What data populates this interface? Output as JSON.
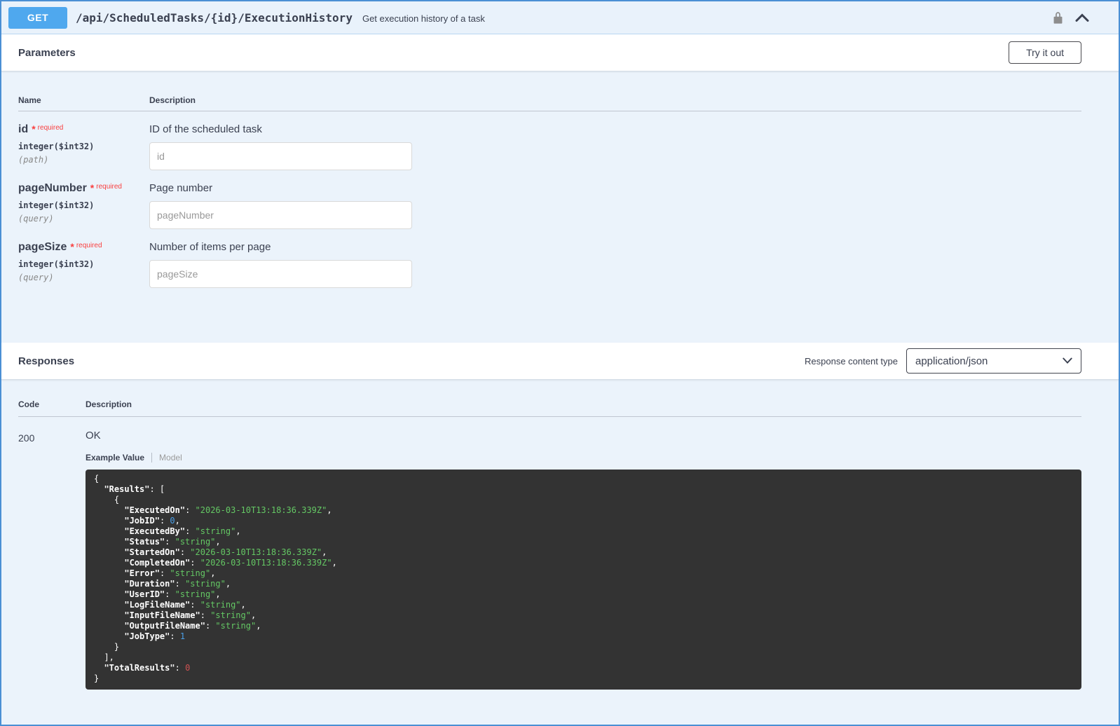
{
  "operation": {
    "method": "GET",
    "path": "/api/ScheduledTasks/{id}/ExecutionHistory",
    "summary": "Get execution history of a task"
  },
  "icons": {
    "lock": "lock-icon",
    "collapse": "chevron-up-icon",
    "select_arrow": "chevron-down-icon"
  },
  "colors": {
    "method_badge": "#4fa8ee",
    "block_background": "#ebf3fb",
    "required": "#f93e3e",
    "code_background": "#333333",
    "string_token": "#64c864",
    "number_token": "#4a9fe8",
    "total_results_token": "#cf5252"
  },
  "parameters_section": {
    "title": "Parameters",
    "try_it_out_label": "Try it out",
    "name_header": "Name",
    "description_header": "Description",
    "required_star": "*",
    "required_label": "required",
    "params": [
      {
        "name": "id",
        "type": "integer($int32)",
        "in": "(path)",
        "description": "ID of the scheduled task",
        "placeholder": "id"
      },
      {
        "name": "pageNumber",
        "type": "integer($int32)",
        "in": "(query)",
        "description": "Page number",
        "placeholder": "pageNumber"
      },
      {
        "name": "pageSize",
        "type": "integer($int32)",
        "in": "(query)",
        "description": "Number of items per page",
        "placeholder": "pageSize"
      }
    ]
  },
  "responses_section": {
    "title": "Responses",
    "content_type_label": "Response content type",
    "content_type_value": "application/json",
    "code_header": "Code",
    "description_header": "Description",
    "responses": [
      {
        "code": "200",
        "description": "OK",
        "example_tab_label": "Example Value",
        "model_tab_label": "Model",
        "example_lines": [
          [
            [
              "{",
              "p"
            ]
          ],
          [
            [
              "  ",
              "p"
            ],
            [
              "\"Results\"",
              "k"
            ],
            [
              ": [",
              "p"
            ]
          ],
          [
            [
              "    {",
              "p"
            ]
          ],
          [
            [
              "      ",
              "p"
            ],
            [
              "\"ExecutedOn\"",
              "k"
            ],
            [
              ": ",
              "p"
            ],
            [
              "\"2026-03-10T13:18:36.339Z\"",
              "s"
            ],
            [
              ",",
              "p"
            ]
          ],
          [
            [
              "      ",
              "p"
            ],
            [
              "\"JobID\"",
              "k"
            ],
            [
              ": ",
              "p"
            ],
            [
              "0",
              "n"
            ],
            [
              ",",
              "p"
            ]
          ],
          [
            [
              "      ",
              "p"
            ],
            [
              "\"ExecutedBy\"",
              "k"
            ],
            [
              ": ",
              "p"
            ],
            [
              "\"string\"",
              "s"
            ],
            [
              ",",
              "p"
            ]
          ],
          [
            [
              "      ",
              "p"
            ],
            [
              "\"Status\"",
              "k"
            ],
            [
              ": ",
              "p"
            ],
            [
              "\"string\"",
              "s"
            ],
            [
              ",",
              "p"
            ]
          ],
          [
            [
              "      ",
              "p"
            ],
            [
              "\"StartedOn\"",
              "k"
            ],
            [
              ": ",
              "p"
            ],
            [
              "\"2026-03-10T13:18:36.339Z\"",
              "s"
            ],
            [
              ",",
              "p"
            ]
          ],
          [
            [
              "      ",
              "p"
            ],
            [
              "\"CompletedOn\"",
              "k"
            ],
            [
              ": ",
              "p"
            ],
            [
              "\"2026-03-10T13:18:36.339Z\"",
              "s"
            ],
            [
              ",",
              "p"
            ]
          ],
          [
            [
              "      ",
              "p"
            ],
            [
              "\"Error\"",
              "k"
            ],
            [
              ": ",
              "p"
            ],
            [
              "\"string\"",
              "s"
            ],
            [
              ",",
              "p"
            ]
          ],
          [
            [
              "      ",
              "p"
            ],
            [
              "\"Duration\"",
              "k"
            ],
            [
              ": ",
              "p"
            ],
            [
              "\"string\"",
              "s"
            ],
            [
              ",",
              "p"
            ]
          ],
          [
            [
              "      ",
              "p"
            ],
            [
              "\"UserID\"",
              "k"
            ],
            [
              ": ",
              "p"
            ],
            [
              "\"string\"",
              "s"
            ],
            [
              ",",
              "p"
            ]
          ],
          [
            [
              "      ",
              "p"
            ],
            [
              "\"LogFileName\"",
              "k"
            ],
            [
              ": ",
              "p"
            ],
            [
              "\"string\"",
              "s"
            ],
            [
              ",",
              "p"
            ]
          ],
          [
            [
              "      ",
              "p"
            ],
            [
              "\"InputFileName\"",
              "k"
            ],
            [
              ": ",
              "p"
            ],
            [
              "\"string\"",
              "s"
            ],
            [
              ",",
              "p"
            ]
          ],
          [
            [
              "      ",
              "p"
            ],
            [
              "\"OutputFileName\"",
              "k"
            ],
            [
              ": ",
              "p"
            ],
            [
              "\"string\"",
              "s"
            ],
            [
              ",",
              "p"
            ]
          ],
          [
            [
              "      ",
              "p"
            ],
            [
              "\"JobType\"",
              "k"
            ],
            [
              ": ",
              "p"
            ],
            [
              "1",
              "n"
            ]
          ],
          [
            [
              "    }",
              "p"
            ]
          ],
          [
            [
              "  ],",
              "p"
            ]
          ],
          [
            [
              "  ",
              "p"
            ],
            [
              "\"TotalResults\"",
              "k"
            ],
            [
              ": ",
              "p"
            ],
            [
              "0",
              "r"
            ]
          ],
          [
            [
              "}",
              "p"
            ]
          ]
        ]
      }
    ]
  }
}
